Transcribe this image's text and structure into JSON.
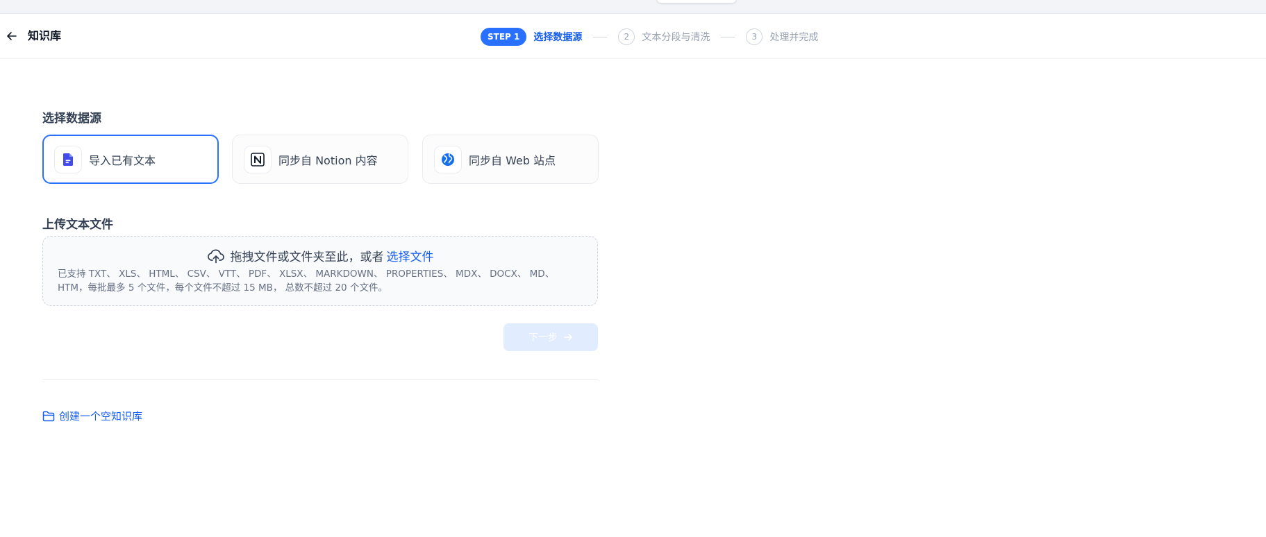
{
  "header": {
    "title": "知识库",
    "back_icon": "arrow-left-icon"
  },
  "steps": {
    "active_badge": "STEP 1",
    "active_label": "选择数据源",
    "items": [
      {
        "number": "2",
        "label": "文本分段与清洗"
      },
      {
        "number": "3",
        "label": "处理并完成"
      }
    ]
  },
  "source": {
    "title": "选择数据源",
    "cards": [
      {
        "label": "导入已有文本",
        "icon": "file-icon"
      },
      {
        "label": "同步自 Notion 内容",
        "icon": "notion-icon"
      },
      {
        "label": "同步自 Web 站点",
        "icon": "globe-icon"
      }
    ]
  },
  "upload": {
    "title": "上传文本文件",
    "drop_text": "拖拽文件或文件夹至此，或者",
    "select_link": "选择文件",
    "hint": "已支持 TXT、 XLS、 HTML、 CSV、 VTT、 PDF、 XLSX、 MARKDOWN、 PROPERTIES、 MDX、 DOCX、 MD、 HTM，每批最多 5 个文件，每个文件不超过 15 MB， 总数不超过 20 个文件。"
  },
  "actions": {
    "next_label": "下一步"
  },
  "footer": {
    "create_empty_label": "创建一个空知识库"
  },
  "colors": {
    "accent": "#2970ff",
    "link": "#155eef",
    "disabled_button": "#e1ecff"
  }
}
